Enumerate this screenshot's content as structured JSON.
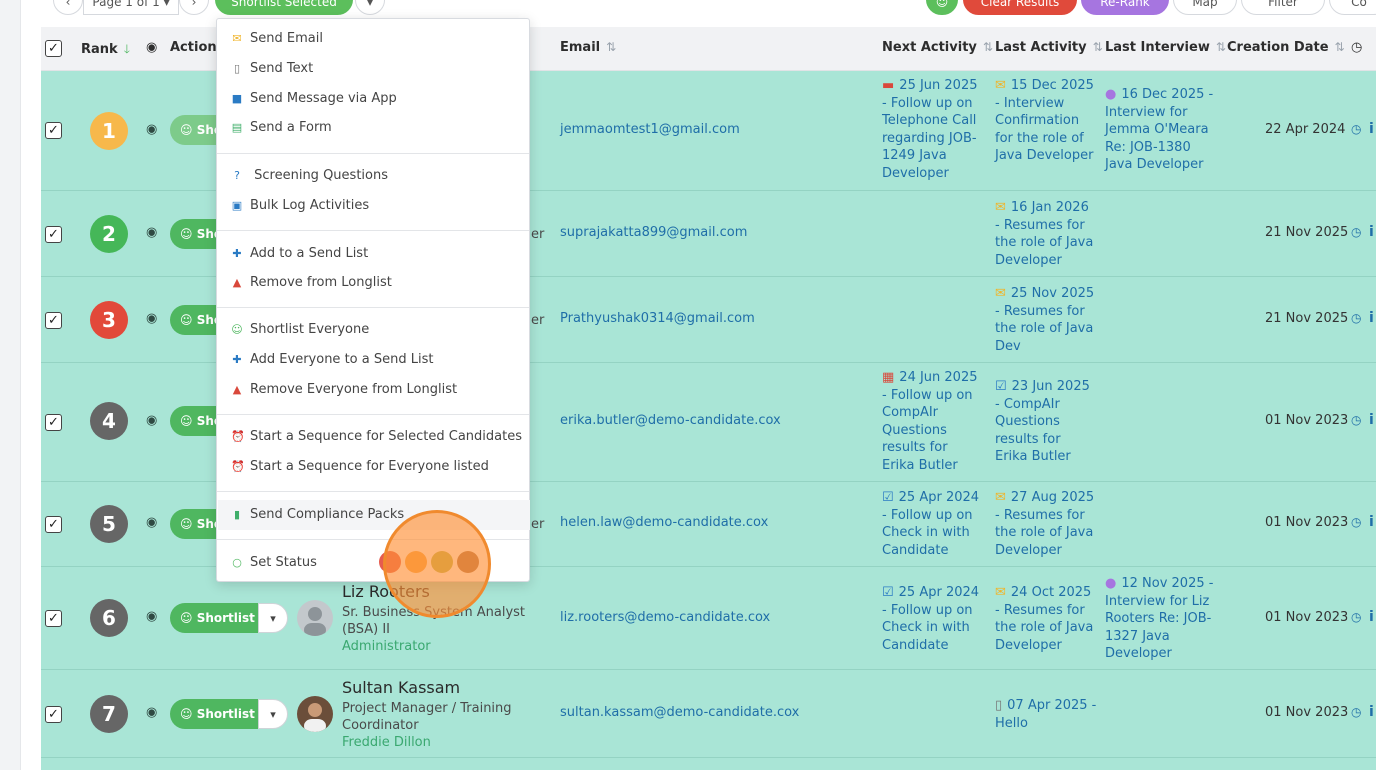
{
  "toolbar": {
    "page_label": "Page 1 of 1",
    "prev_icon": "chevron-left-icon",
    "next_icon": "chevron-right-icon",
    "shortlist_selected": "Shortlist Selected",
    "clear_results": "Clear Results",
    "rerank": "Re-Rank",
    "map": "Map",
    "filter": "Filter",
    "columns": "Co"
  },
  "headers": {
    "rank": "Rank",
    "action": "Action",
    "email": "Email",
    "next_activity": "Next Activity",
    "last_activity": "Last Activity",
    "last_interview": "Last Interview",
    "creation_date": "Creation Date"
  },
  "shortlist_label": "Shortlist",
  "shortlist_truncated": "Sho",
  "rows": [
    {
      "rank": "1",
      "rank_color": "#f7b84b",
      "email": "jemmaomtest1@gmail.com",
      "next": "25 Jun 2025 - Follow up on Telephone Call regarding JOB-1249 Java Developer",
      "last": "15 Dec 2025 - Interview Confirmation for the role of Java Developer",
      "interview": "16 Dec 2025 - Interview for Jemma O'Meara Re: JOB-1380 Java Developer",
      "created": "22 Apr 2024"
    },
    {
      "rank": "2",
      "rank_color": "#45b758",
      "email": "suprajakatta899@gmail.com",
      "clip": "er",
      "next": "",
      "last": "16 Jan 2026 - Resumes for the role of Java Developer",
      "interview": "",
      "created": "21 Nov 2025"
    },
    {
      "rank": "3",
      "rank_color": "#e2493a",
      "email": "Prathyushak0314@gmail.com",
      "clip": "er",
      "next": "",
      "last": "25 Nov 2025 - Resumes for the role of Java Dev",
      "interview": "",
      "created": "21 Nov 2025"
    },
    {
      "rank": "4",
      "rank_color": "#666666",
      "email": "erika.butler@demo-candidate.cox",
      "next": "24 Jun 2025 - Follow up on CompAIr Questions results for Erika Butler",
      "last": "23 Jun 2025 - CompAIr Questions results for Erika Butler",
      "interview": "",
      "created": "01 Nov 2023"
    },
    {
      "rank": "5",
      "rank_color": "#666666",
      "email": "helen.law@demo-candidate.cox",
      "clip": "er",
      "next": "25 Apr 2024 - Follow up on Check in with Candidate",
      "last": "27 Aug 2025 - Resumes for the role of Java Developer",
      "interview": "",
      "created": "01 Nov 2023"
    },
    {
      "rank": "6",
      "rank_color": "#666666",
      "email": "liz.rooters@demo-candidate.cox",
      "name": "Liz Rooters",
      "title": "Sr. Business System Analyst (BSA) II",
      "owner": "Administrator",
      "next": "25 Apr 2024 - Follow up on Check in with Candidate",
      "last": "24 Oct 2025 - Resumes for the role of Java Developer",
      "interview": "12 Nov 2025 - Interview for Liz Rooters Re: JOB-1327 Java Developer",
      "created": "01 Nov 2023"
    },
    {
      "rank": "7",
      "rank_color": "#666666",
      "email": "sultan.kassam@demo-candidate.cox",
      "name": "Sultan Kassam",
      "title": "Project Manager / Training Coordinator",
      "owner": "Freddie Dillon",
      "next": "",
      "last": "07 Apr 2025 - Hello",
      "interview": "",
      "created": "01 Nov 2023"
    }
  ],
  "menu": {
    "items": [
      {
        "label": "Send Email",
        "icon": "envelope-icon",
        "color": "#f0b429"
      },
      {
        "label": "Send Text",
        "icon": "mobile-icon",
        "color": "#777777"
      },
      {
        "label": "Send Message via App",
        "icon": "chat-bubble-icon",
        "color": "#2b7bc4"
      },
      {
        "label": "Send a Form",
        "icon": "form-icon",
        "color": "#3fae6a"
      },
      {
        "label": "Screening Questions",
        "icon": "question-icon",
        "color": "#2b7bc4"
      },
      {
        "label": "Bulk Log Activities",
        "icon": "inbox-icon",
        "color": "#2b7bc4"
      },
      {
        "label": "Add to a Send List",
        "icon": "user-plus-icon",
        "color": "#2b7bc4"
      },
      {
        "label": "Remove from Longlist",
        "icon": "user-minus-icon",
        "color": "#d9483b"
      },
      {
        "label": "Shortlist Everyone",
        "icon": "users-icon",
        "color": "#4fb760"
      },
      {
        "label": "Add Everyone to a Send List",
        "icon": "user-plus-icon",
        "color": "#2b7bc4"
      },
      {
        "label": "Remove Everyone from Longlist",
        "icon": "user-minus-icon",
        "color": "#d9483b"
      },
      {
        "label": "Start a Sequence for Selected Candidates",
        "icon": "alarm-icon",
        "color": "#2b7bc4"
      },
      {
        "label": "Start a Sequence for Everyone listed",
        "icon": "alarm-icon",
        "color": "#2b7bc4"
      },
      {
        "label": "Send Compliance Packs",
        "icon": "clipboard-icon",
        "color": "#3fae6a"
      },
      {
        "label": "Set Status",
        "icon": "circle-icon",
        "color": "#4fb760"
      }
    ],
    "status_colors": [
      "#e65c4f",
      "#f5a742",
      "#b8b84a",
      "#a87149"
    ]
  }
}
